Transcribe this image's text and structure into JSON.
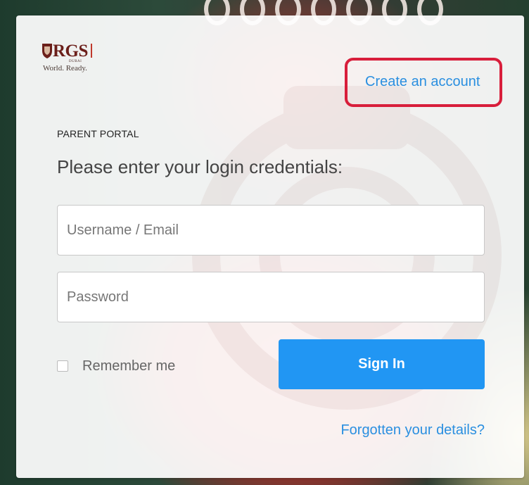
{
  "brand": {
    "logo_text": "RGS",
    "logo_sub": "DUBAI",
    "tagline": "World. Ready.",
    "color": "#6b1f1a"
  },
  "header": {
    "create_account_label": "Create an account",
    "highlight_color": "#d81e3b"
  },
  "form": {
    "section_label": "PARENT PORTAL",
    "prompt": "Please enter your login credentials:",
    "username_placeholder": "Username / Email",
    "username_value": "",
    "password_placeholder": "Password",
    "password_value": "",
    "remember_label": "Remember me",
    "remember_checked": false,
    "sign_in_label": "Sign In",
    "forgot_label": "Forgotten your details?",
    "accent_color": "#2196f3"
  }
}
